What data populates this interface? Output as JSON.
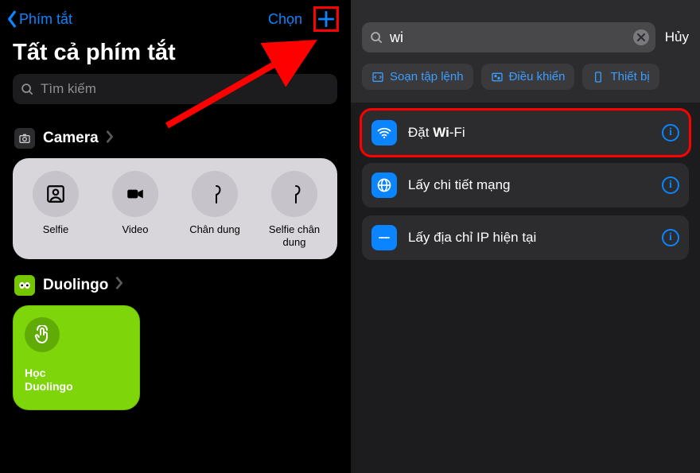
{
  "left": {
    "back_label": "Phím tắt",
    "select_label": "Chọn",
    "title": "Tất cả phím tắt",
    "search_placeholder": "Tìm kiếm",
    "sections": {
      "camera": {
        "label": "Camera",
        "tiles": [
          {
            "label": "Selfie"
          },
          {
            "label": "Video"
          },
          {
            "label": "Chân dung"
          },
          {
            "label": "Selfie chân dung"
          }
        ]
      },
      "duolingo": {
        "label": "Duolingo",
        "tile_label": "Học\nDuolingo"
      }
    }
  },
  "right": {
    "query": "wi",
    "cancel_label": "Hủy",
    "chips": [
      {
        "label": "Soạn tập lệnh"
      },
      {
        "label": "Điều khiển"
      },
      {
        "label": "Thiết bị"
      }
    ],
    "results": [
      {
        "label_pre": "Đặt ",
        "label_bold": "Wi",
        "label_post": "-Fi",
        "highlight": true
      },
      {
        "label_pre": "Lấy chi tiết mạng",
        "label_bold": "",
        "label_post": "",
        "highlight": false
      },
      {
        "label_pre": "Lấy địa chỉ IP hiện tại",
        "label_bold": "",
        "label_post": "",
        "highlight": false
      }
    ]
  }
}
